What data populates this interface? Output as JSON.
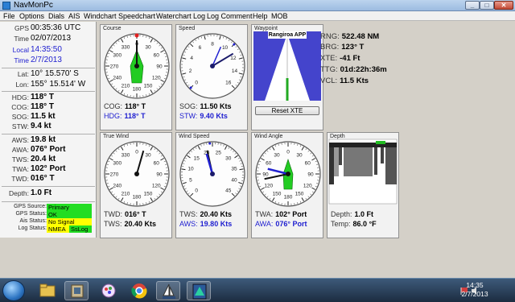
{
  "window": {
    "title": "NavMonPc"
  },
  "menu": [
    "File",
    "Options",
    "Dials",
    "AIS",
    "Windchart",
    "Speedchart",
    "Waterchart",
    "Log",
    "Log Comment",
    "Help",
    "MOB"
  ],
  "left": {
    "gps": {
      "label": "GPS",
      "value": "00:35:36 UTC"
    },
    "time": {
      "label": "Time",
      "value": "02/07/2013"
    },
    "local": {
      "label": "Local",
      "value": "14:35:50"
    },
    "ltime": {
      "label": "Time",
      "value": "2/7/2013"
    },
    "lat": {
      "label": "Lat:",
      "value": "10° 15.570' S"
    },
    "lon": {
      "label": "Lon:",
      "value": "155° 15.514' W"
    },
    "hdg": {
      "label": "HDG:",
      "value": "118° T"
    },
    "cog": {
      "label": "COG:",
      "value": "118° T"
    },
    "sog": {
      "label": "SOG:",
      "value": "11.5 kt"
    },
    "stw": {
      "label": "STW:",
      "value": "9.4 kt"
    },
    "aws": {
      "label": "AWS:",
      "value": "19.8 kt"
    },
    "awa": {
      "label": "AWA:",
      "value": "076° Port"
    },
    "tws": {
      "label": "TWS:",
      "value": "20.4 kt"
    },
    "twa": {
      "label": "TWA:",
      "value": "102° Port"
    },
    "twd": {
      "label": "TWD:",
      "value": "016° T"
    },
    "depth": {
      "label": "Depth:",
      "value": "1.0 Ft"
    },
    "status": {
      "gps_source": {
        "label": "GPS Source:",
        "value": "Primary"
      },
      "gps_status": {
        "label": "GPS Status:",
        "value": "OK"
      },
      "ais_status": {
        "label": "Ais Status:",
        "value": "No Signal"
      },
      "log_status": {
        "label": "Log Status:",
        "value": "NMEA",
        "value2": "SsLog"
      }
    }
  },
  "dials": {
    "course": {
      "title": "Course",
      "readouts": [
        {
          "label": "COG:",
          "value": "118° T"
        },
        {
          "label": "HDG:",
          "value": "118° T"
        }
      ],
      "ticks": [
        "0",
        "30",
        "60",
        "90",
        "120",
        "150",
        "180",
        "210",
        "240",
        "270",
        "300",
        "330"
      ],
      "needle_deg": 118
    },
    "speed": {
      "title": "Speed",
      "readouts": [
        {
          "label": "SOG:",
          "value": "11.50 Kts"
        },
        {
          "label": "STW:",
          "value": "9.40 Kts"
        }
      ],
      "ticks": [
        "0",
        "2",
        "4",
        "6",
        "8",
        "10",
        "12",
        "14",
        "16"
      ]
    },
    "true_wind": {
      "title": "True Wind",
      "readouts": [
        {
          "label": "TWD:",
          "value": "016° T"
        },
        {
          "label": "TWS:",
          "value": "20.40 Kts"
        }
      ],
      "ticks": [
        "0",
        "30",
        "60",
        "90",
        "120",
        "150",
        "180",
        "210",
        "240",
        "270",
        "300",
        "330"
      ],
      "needle_deg": 16
    },
    "wind_speed": {
      "title": "Wind Speed",
      "readouts": [
        {
          "label": "TWS:",
          "value": "20.40 Kts"
        },
        {
          "label": "AWS:",
          "value": "19.80 Kts"
        }
      ],
      "ticks": [
        "0",
        "5",
        "10",
        "15",
        "20",
        "25",
        "30",
        "35",
        "40",
        "45"
      ]
    },
    "wind_angle": {
      "title": "Wind Angle",
      "readouts": [
        {
          "label": "TWA:",
          "value": "102° Port"
        },
        {
          "label": "AWA:",
          "value": "076° Port"
        }
      ],
      "ticks": [
        "0",
        "30",
        "60",
        "90",
        "120",
        "150",
        "180",
        "150",
        "120",
        "90",
        "60",
        "30"
      ]
    }
  },
  "waypoint": {
    "title": "Waypoint",
    "name": "Rangiroa APP",
    "reset_label": "Reset XTE",
    "rng": {
      "label": "RNG:",
      "value": "522.48 NM"
    },
    "brg": {
      "label": "BRG:",
      "value": "123° T"
    },
    "xte": {
      "label": "XTE:",
      "value": "-41 Ft"
    },
    "ttg": {
      "label": "TTG:",
      "value": "01d:22h:36m"
    },
    "vcl": {
      "label": "VCL:",
      "value": "11.5 Kts"
    }
  },
  "depth_panel": {
    "title": "Depth",
    "readouts": [
      {
        "label": "Depth:",
        "value": "1.0 Ft"
      },
      {
        "label": "Temp:",
        "value": "86.0 °F"
      }
    ]
  },
  "taskbar": {
    "time": "14:35",
    "date": "2/7/2013"
  },
  "colors": {
    "accent_blue": "#2020d0",
    "status_green": "#22dd22",
    "status_yellow": "#ffff00",
    "boat_green": "#22cc22",
    "waypoint_blue": "#4444cc"
  }
}
